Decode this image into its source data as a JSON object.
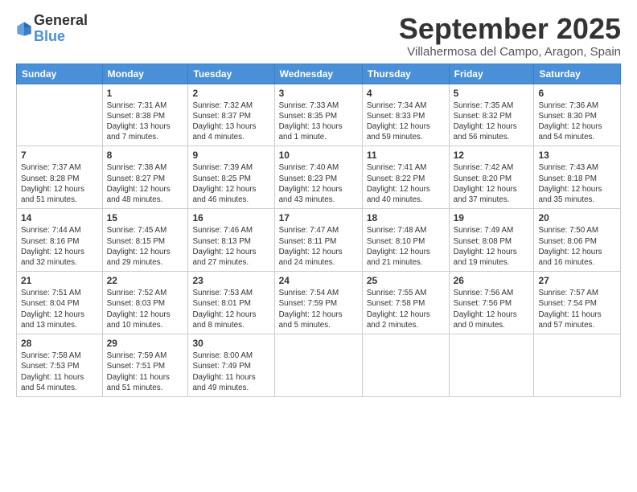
{
  "logo": {
    "general": "General",
    "blue": "Blue"
  },
  "title": "September 2025",
  "subtitle": "Villahermosa del Campo, Aragon, Spain",
  "days_of_week": [
    "Sunday",
    "Monday",
    "Tuesday",
    "Wednesday",
    "Thursday",
    "Friday",
    "Saturday"
  ],
  "weeks": [
    [
      {
        "num": "",
        "info": ""
      },
      {
        "num": "1",
        "info": "Sunrise: 7:31 AM\nSunset: 8:38 PM\nDaylight: 13 hours\nand 7 minutes."
      },
      {
        "num": "2",
        "info": "Sunrise: 7:32 AM\nSunset: 8:37 PM\nDaylight: 13 hours\nand 4 minutes."
      },
      {
        "num": "3",
        "info": "Sunrise: 7:33 AM\nSunset: 8:35 PM\nDaylight: 13 hours\nand 1 minute."
      },
      {
        "num": "4",
        "info": "Sunrise: 7:34 AM\nSunset: 8:33 PM\nDaylight: 12 hours\nand 59 minutes."
      },
      {
        "num": "5",
        "info": "Sunrise: 7:35 AM\nSunset: 8:32 PM\nDaylight: 12 hours\nand 56 minutes."
      },
      {
        "num": "6",
        "info": "Sunrise: 7:36 AM\nSunset: 8:30 PM\nDaylight: 12 hours\nand 54 minutes."
      }
    ],
    [
      {
        "num": "7",
        "info": "Sunrise: 7:37 AM\nSunset: 8:28 PM\nDaylight: 12 hours\nand 51 minutes."
      },
      {
        "num": "8",
        "info": "Sunrise: 7:38 AM\nSunset: 8:27 PM\nDaylight: 12 hours\nand 48 minutes."
      },
      {
        "num": "9",
        "info": "Sunrise: 7:39 AM\nSunset: 8:25 PM\nDaylight: 12 hours\nand 46 minutes."
      },
      {
        "num": "10",
        "info": "Sunrise: 7:40 AM\nSunset: 8:23 PM\nDaylight: 12 hours\nand 43 minutes."
      },
      {
        "num": "11",
        "info": "Sunrise: 7:41 AM\nSunset: 8:22 PM\nDaylight: 12 hours\nand 40 minutes."
      },
      {
        "num": "12",
        "info": "Sunrise: 7:42 AM\nSunset: 8:20 PM\nDaylight: 12 hours\nand 37 minutes."
      },
      {
        "num": "13",
        "info": "Sunrise: 7:43 AM\nSunset: 8:18 PM\nDaylight: 12 hours\nand 35 minutes."
      }
    ],
    [
      {
        "num": "14",
        "info": "Sunrise: 7:44 AM\nSunset: 8:16 PM\nDaylight: 12 hours\nand 32 minutes."
      },
      {
        "num": "15",
        "info": "Sunrise: 7:45 AM\nSunset: 8:15 PM\nDaylight: 12 hours\nand 29 minutes."
      },
      {
        "num": "16",
        "info": "Sunrise: 7:46 AM\nSunset: 8:13 PM\nDaylight: 12 hours\nand 27 minutes."
      },
      {
        "num": "17",
        "info": "Sunrise: 7:47 AM\nSunset: 8:11 PM\nDaylight: 12 hours\nand 24 minutes."
      },
      {
        "num": "18",
        "info": "Sunrise: 7:48 AM\nSunset: 8:10 PM\nDaylight: 12 hours\nand 21 minutes."
      },
      {
        "num": "19",
        "info": "Sunrise: 7:49 AM\nSunset: 8:08 PM\nDaylight: 12 hours\nand 19 minutes."
      },
      {
        "num": "20",
        "info": "Sunrise: 7:50 AM\nSunset: 8:06 PM\nDaylight: 12 hours\nand 16 minutes."
      }
    ],
    [
      {
        "num": "21",
        "info": "Sunrise: 7:51 AM\nSunset: 8:04 PM\nDaylight: 12 hours\nand 13 minutes."
      },
      {
        "num": "22",
        "info": "Sunrise: 7:52 AM\nSunset: 8:03 PM\nDaylight: 12 hours\nand 10 minutes."
      },
      {
        "num": "23",
        "info": "Sunrise: 7:53 AM\nSunset: 8:01 PM\nDaylight: 12 hours\nand 8 minutes."
      },
      {
        "num": "24",
        "info": "Sunrise: 7:54 AM\nSunset: 7:59 PM\nDaylight: 12 hours\nand 5 minutes."
      },
      {
        "num": "25",
        "info": "Sunrise: 7:55 AM\nSunset: 7:58 PM\nDaylight: 12 hours\nand 2 minutes."
      },
      {
        "num": "26",
        "info": "Sunrise: 7:56 AM\nSunset: 7:56 PM\nDaylight: 12 hours\nand 0 minutes."
      },
      {
        "num": "27",
        "info": "Sunrise: 7:57 AM\nSunset: 7:54 PM\nDaylight: 11 hours\nand 57 minutes."
      }
    ],
    [
      {
        "num": "28",
        "info": "Sunrise: 7:58 AM\nSunset: 7:53 PM\nDaylight: 11 hours\nand 54 minutes."
      },
      {
        "num": "29",
        "info": "Sunrise: 7:59 AM\nSunset: 7:51 PM\nDaylight: 11 hours\nand 51 minutes."
      },
      {
        "num": "30",
        "info": "Sunrise: 8:00 AM\nSunset: 7:49 PM\nDaylight: 11 hours\nand 49 minutes."
      },
      {
        "num": "",
        "info": ""
      },
      {
        "num": "",
        "info": ""
      },
      {
        "num": "",
        "info": ""
      },
      {
        "num": "",
        "info": ""
      }
    ]
  ]
}
